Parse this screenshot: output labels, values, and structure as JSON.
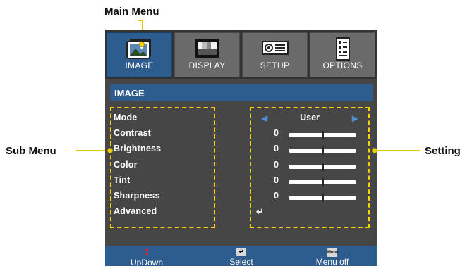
{
  "callouts": {
    "main_menu": "Main Menu",
    "sub_menu": "Sub Menu",
    "setting": "Setting"
  },
  "osd": {
    "tabs": [
      {
        "label": "IMAGE",
        "icon": "image-photo-icon",
        "active": true
      },
      {
        "label": "DISPLAY",
        "icon": "display-screen-icon",
        "active": false
      },
      {
        "label": "SETUP",
        "icon": "projector-icon",
        "active": false
      },
      {
        "label": "OPTIONS",
        "icon": "checklist-icon",
        "active": false
      }
    ],
    "section_title": "IMAGE",
    "items": [
      {
        "label": "Mode"
      },
      {
        "label": "Contrast"
      },
      {
        "label": "Brightness"
      },
      {
        "label": "Color"
      },
      {
        "label": "Tint"
      },
      {
        "label": "Sharpness"
      },
      {
        "label": "Advanced"
      }
    ],
    "settings": {
      "mode_value": "User",
      "sliders": [
        {
          "value": "0",
          "level": 0.5
        },
        {
          "value": "0",
          "level": 0.5
        },
        {
          "value": "0",
          "level": 0.5
        },
        {
          "value": "0",
          "level": 0.5
        },
        {
          "value": "0",
          "level": 0.5
        }
      ],
      "advanced_symbol": "↵"
    },
    "hints": [
      {
        "label": "UpDown",
        "icon": "up-down-arrows-icon"
      },
      {
        "label": "Select",
        "icon": "enter-key-icon",
        "key": "↵"
      },
      {
        "label": "Menu off",
        "icon": "menu-key-icon",
        "key": "Menu"
      }
    ]
  },
  "colors": {
    "accent_blue": "#2c5d8e",
    "panel_gray": "#464646",
    "highlight_yellow": "#f3d400",
    "arrow_blue": "#4d8fd6",
    "updown_red": "#e0202a"
  }
}
